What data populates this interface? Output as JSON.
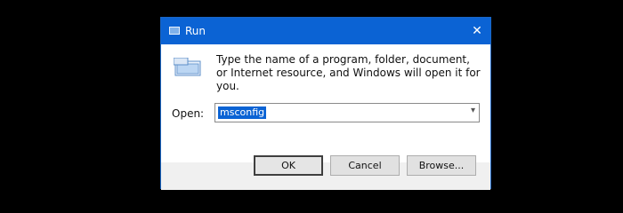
{
  "window": {
    "title": "Run",
    "close_glyph": "✕",
    "description": "Type the name of a program, folder, document, or Internet resource, and Windows will open it for you.",
    "open_label": "Open:",
    "open_value": "msconfig",
    "dropdown_glyph": "▾"
  },
  "buttons": {
    "ok": "OK",
    "cancel": "Cancel",
    "browse": "Browse..."
  },
  "icons": {
    "app": "run-icon",
    "dialog": "run-dialog-icon"
  },
  "colors": {
    "accent": "#0b63d4",
    "background": "#000000"
  }
}
